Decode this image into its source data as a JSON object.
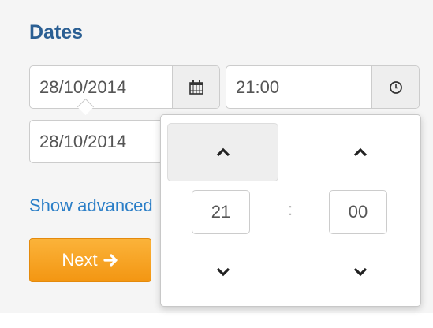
{
  "section": {
    "title": "Dates"
  },
  "start": {
    "date": "28/10/2014",
    "time": "21:00"
  },
  "end": {
    "date": "28/10/2014"
  },
  "advanced_link": "Show advanced",
  "next_button": {
    "label": "Next"
  },
  "time_picker": {
    "hour": "21",
    "separator": ":",
    "minute": "00"
  },
  "icons": {
    "date_addon": "calendar-icon",
    "time_addon": "clock-icon",
    "next": "arrow-right-icon",
    "increment": "chevron-up-icon",
    "decrement": "chevron-down-icon"
  },
  "colors": {
    "title": "#2b5f93",
    "link": "#2a7ec7",
    "next_button": "#f7a320"
  }
}
